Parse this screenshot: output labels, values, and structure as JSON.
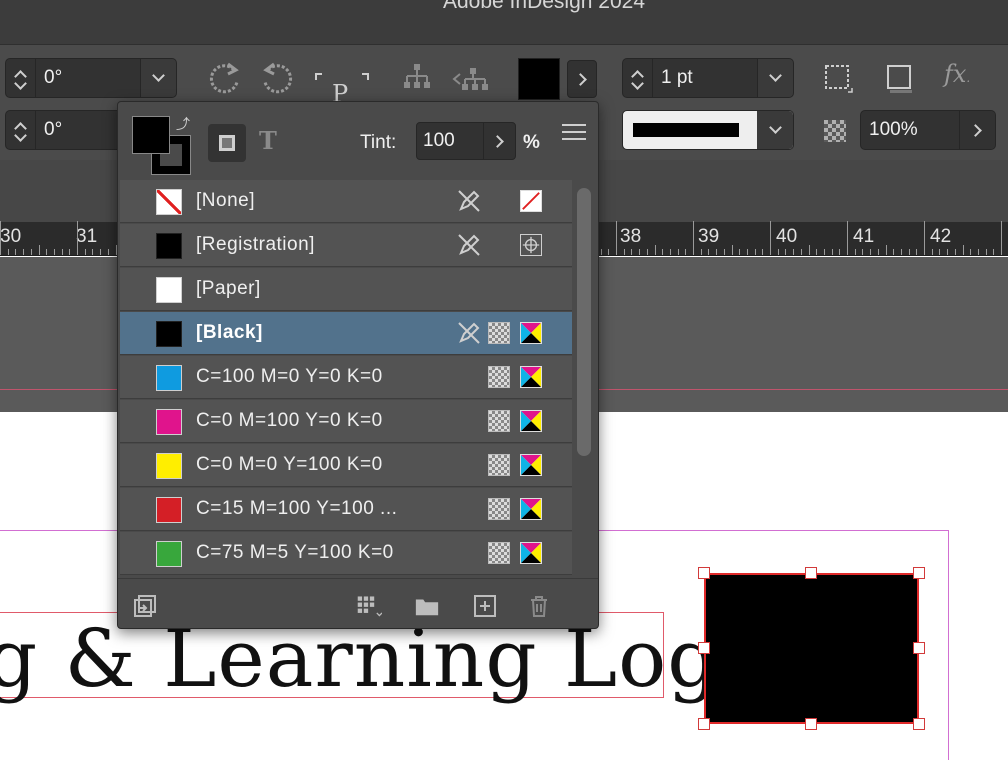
{
  "app": {
    "title": "Adobe InDesign 2024"
  },
  "control_bar": {
    "rotate_angle": "0°",
    "shear_angle": "0°",
    "stroke_weight": "1 pt",
    "opacity": "100%",
    "fill_color": "#000000"
  },
  "ruler": {
    "numbers": [
      "30",
      "31",
      "38",
      "39",
      "40",
      "41",
      "42"
    ]
  },
  "swatches_panel": {
    "tint_label": "Tint:",
    "tint_value": "100",
    "tint_unit": "%",
    "items": [
      {
        "name": "[None]",
        "color": "none",
        "locked": true,
        "type": "none"
      },
      {
        "name": "[Registration]",
        "color": "#000000",
        "locked": true,
        "type": "registration"
      },
      {
        "name": "[Paper]",
        "color": "#ffffff",
        "locked": false,
        "type": ""
      },
      {
        "name": "[Black]",
        "color": "#000000",
        "locked": true,
        "type": "cmyk",
        "selected": true
      },
      {
        "name": "C=100 M=0 Y=0 K=0",
        "color": "#0f9be0",
        "locked": false,
        "type": "cmyk"
      },
      {
        "name": "C=0 M=100 Y=0 K=0",
        "color": "#e0148c",
        "locked": false,
        "type": "cmyk"
      },
      {
        "name": "C=0 M=0 Y=100 K=0",
        "color": "#ffee00",
        "locked": false,
        "type": "cmyk"
      },
      {
        "name": "C=15 M=100 Y=100 ...",
        "color": "#d41f26",
        "locked": false,
        "type": "cmyk"
      },
      {
        "name": "C=75 M=5 Y=100 K=0",
        "color": "#38a73c",
        "locked": false,
        "type": "cmyk"
      }
    ]
  },
  "document": {
    "headline": "g & Learning Log",
    "rectangle_fill": "#000000"
  }
}
